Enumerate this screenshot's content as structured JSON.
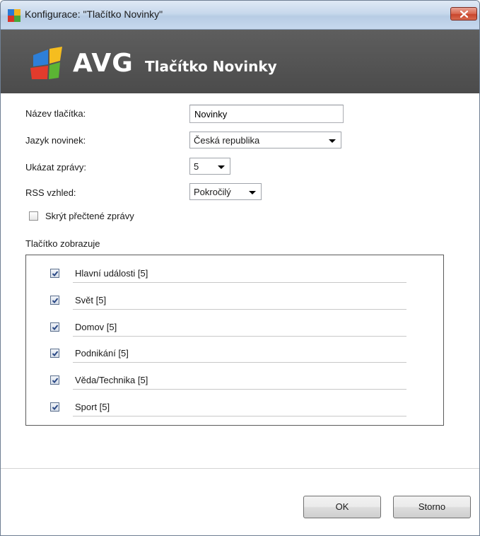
{
  "window": {
    "title": "Konfigurace: \"Tlačítko Novinky\""
  },
  "banner": {
    "logo_text": "AVG",
    "title": "Tlačítko Novinky"
  },
  "form": {
    "button_name": {
      "label": "Název tlačítka:",
      "value": "Novinky"
    },
    "news_language": {
      "label": "Jazyk novinek:",
      "selected": "Česká republika"
    },
    "show_messages": {
      "label": "Ukázat zprávy:",
      "selected": "5"
    },
    "rss_look": {
      "label": "RSS vzhled:",
      "selected": "Pokročilý"
    },
    "hide_read": {
      "label": "Skrýt přečtené zprávy",
      "checked": false
    }
  },
  "group": {
    "label": "Tlačítko zobrazuje",
    "items": [
      {
        "label": "Hlavní události [5]",
        "checked": true
      },
      {
        "label": "Svět [5]",
        "checked": true
      },
      {
        "label": "Domov [5]",
        "checked": true
      },
      {
        "label": "Podnikání [5]",
        "checked": true
      },
      {
        "label": "Věda/Technika [5]",
        "checked": true
      },
      {
        "label": "Sport [5]",
        "checked": true
      }
    ]
  },
  "buttons": {
    "ok": "OK",
    "cancel": "Storno"
  },
  "colors": {
    "banner_bg": "#4f4f4f",
    "close_button": "#c8452c"
  }
}
